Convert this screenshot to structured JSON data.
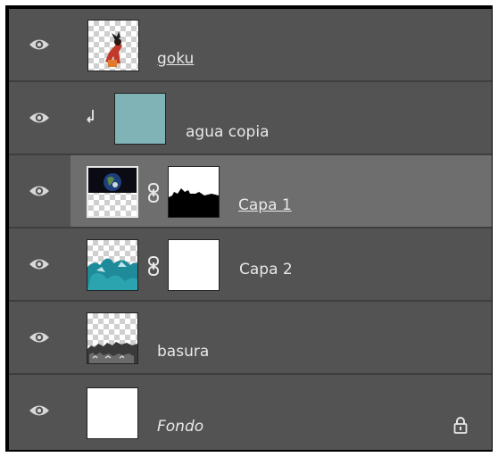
{
  "layers": [
    {
      "name": "goku",
      "style": "underline",
      "visible": true
    },
    {
      "name": "agua copia",
      "style": "normal",
      "visible": true,
      "clipped": true
    },
    {
      "name": "Capa 1",
      "style": "underline",
      "visible": true,
      "selected": true,
      "has_mask": true
    },
    {
      "name": "Capa 2",
      "style": "normal",
      "visible": true,
      "has_mask": true
    },
    {
      "name": "basura",
      "style": "normal",
      "visible": true
    },
    {
      "name": "Fondo",
      "style": "italic",
      "visible": true,
      "locked": true
    }
  ],
  "colors": {
    "panel": "#535353",
    "selected": "#6e6e6e",
    "divider": "#3e3e3e",
    "text": "#e8e8e8",
    "agua": "#7fb3b5"
  },
  "icons": {
    "visibility": "eye-icon",
    "link": "chain-link-icon",
    "clip": "clipping-arrow-icon",
    "lock": "lock-icon"
  }
}
